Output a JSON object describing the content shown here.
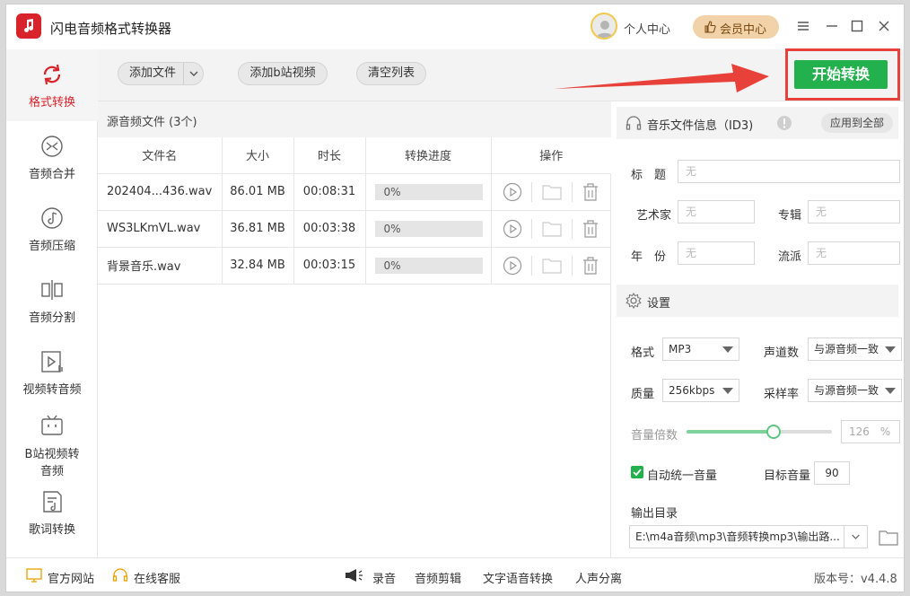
{
  "app": {
    "title": "闪电音频格式转换器"
  },
  "header": {
    "user_center": "个人中心",
    "vip_center": "会员中心"
  },
  "sidebar": {
    "items": [
      {
        "label": "格式转换",
        "icon": "refresh-icon"
      },
      {
        "label": "音频合并",
        "icon": "merge-icon"
      },
      {
        "label": "音频压缩",
        "icon": "compress-icon"
      },
      {
        "label": "音频分割",
        "icon": "split-icon"
      },
      {
        "label": "视频转音频",
        "icon": "video-audio-icon"
      },
      {
        "label": "B站视频转",
        "label2": "音频",
        "icon": "bilibili-icon"
      },
      {
        "label": "歌词转换",
        "icon": "lyrics-icon"
      }
    ]
  },
  "toolbar": {
    "add_file": "添加文件",
    "add_bilibili": "添加b站视频",
    "clear_list": "清空列表",
    "start_convert": "开始转换"
  },
  "files": {
    "header": "源音频文件 (3个)",
    "columns": [
      "文件名",
      "大小",
      "时长",
      "转换进度",
      "操作"
    ],
    "rows": [
      {
        "name": "202404...436.wav",
        "size": "86.01 MB",
        "duration": "00:08:31",
        "progress": "0%",
        "progress_value": 0
      },
      {
        "name": "WS3LKmVL.wav",
        "size": "36.81 MB",
        "duration": "00:03:38",
        "progress": "0%",
        "progress_value": 0
      },
      {
        "name": "背景音乐.wav",
        "size": "32.84 MB",
        "duration": "00:03:15",
        "progress": "0%",
        "progress_value": 0
      }
    ]
  },
  "id3": {
    "title": "音乐文件信息（ID3)",
    "apply_all": "应用到全部",
    "labels": {
      "title": "标　题",
      "artist": "艺术家",
      "album": "专辑",
      "year": "年　份",
      "genre": "流派"
    },
    "placeholder": "无"
  },
  "settings": {
    "title": "设置",
    "format_label": "格式",
    "format_value": "MP3",
    "channels_label": "声道数",
    "channels_value": "与源音频一致",
    "quality_label": "质量",
    "quality_value": "256kbps",
    "samplerate_label": "采样率",
    "samplerate_value": "与源音频一致",
    "volume_label": "音量倍数",
    "volume_value": "126",
    "volume_unit": "%",
    "volume_fraction": 0.6,
    "auto_volume_label": "自动统一音量",
    "auto_volume_checked": true,
    "target_volume_label": "目标音量",
    "target_volume_value": "90",
    "output_label": "输出目录",
    "output_path": "E:\\m4a音频\\mp3\\音频转换mp3\\输出路..."
  },
  "bottom": {
    "website": "官方网站",
    "support": "在线客服",
    "record": "录音",
    "audio_edit": "音频剪辑",
    "text_speech": "文字语音转换",
    "vocal_split": "人声分离",
    "version": "版本号：v4.4.8"
  },
  "colors": {
    "brand": "#d8232a",
    "accent_green": "#22b14c",
    "highlight": "#e8413a"
  }
}
